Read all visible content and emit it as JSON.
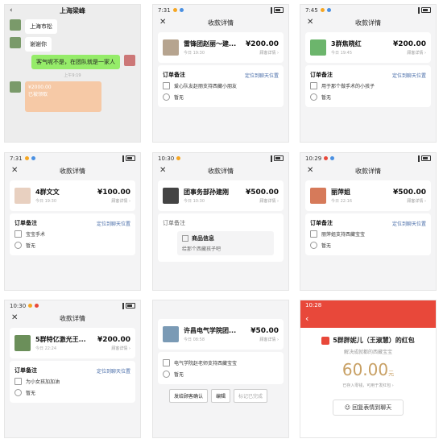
{
  "panels": {
    "p1": {
      "title": "上海梁峰",
      "msg_top": "上海市松",
      "msg_thanks": "谢谢你",
      "msg_reply": "客气呢不是，在团队就是一家人",
      "timestamp": "上午9:19",
      "rp_amount": "¥2000.00",
      "rp_label": "已被领取"
    },
    "p2": {
      "time": "7:31",
      "nav_title": "收款详情",
      "payer": "雷锋团赵丽～建...",
      "date": "今日 19:30",
      "amount": "¥200.00",
      "detail": "顾客详情 ›",
      "note_head": "订单备注",
      "locate": "定位到聊天位置",
      "note_text": "爱心队友赵丽支持西藏小朋友",
      "none_text": "暂无"
    },
    "p3": {
      "time": "7:45",
      "nav_title": "收款详情",
      "payer": "3群焦晓红",
      "date": "今日 19:45",
      "amount": "¥200.00",
      "detail": "顾客详情 ›",
      "note_head": "订单备注",
      "locate": "定位到聊天位置",
      "note_text": "用于那个做手术的小孩子",
      "none_text": "暂无"
    },
    "p4": {
      "time": "7:31",
      "nav_title": "收款详情",
      "payer": "4群文文",
      "date": "今日 19:30",
      "amount": "¥100.00",
      "detail": "顾客详情 ›",
      "note_head": "订单备注",
      "locate": "定位到聊天位置",
      "note_text": "宝宝手术",
      "none_text": "暂无"
    },
    "p5": {
      "time": "10:30",
      "nav_title": "收款详情",
      "payer": "团事务部孙建刚",
      "date": "今日 10:30",
      "amount": "¥500.00",
      "detail": "顾客详情 ›",
      "note_head": "订单备注",
      "prod_title": "商品信息",
      "prod_sub": "给那个西藏孩子吧"
    },
    "p6": {
      "time": "10:29",
      "nav_title": "收款详情",
      "payer": "丽萍姐",
      "date": "今日 22:16",
      "amount": "¥500.00",
      "detail": "顾客详情 ›",
      "note_head": "订单备注",
      "locate": "定位到聊天位置",
      "note_text": "丽萍姐支持西藏宝宝",
      "none_text": "暂无"
    },
    "p7": {
      "time": "10:30",
      "nav_title": "收款详情",
      "payer": "5群特亿激光王...",
      "date": "今日 22:24",
      "amount": "¥200.00",
      "detail": "顾客详情 ›",
      "note_head": "订单备注",
      "locate": "定位到聊天位置",
      "note_text": "为小女孩加加油",
      "none_text": "暂无"
    },
    "p8": {
      "payer": "许昌电气学院团...",
      "date": "今日 08:58",
      "amount": "¥50.00",
      "detail": "顾客详情 ›",
      "note_text": "电气学院赵老师支持西藏宝宝",
      "none_text": "暂无",
      "btn_send": "发给顾客确认",
      "btn_edit": "编辑",
      "btn_done": "标记已完成"
    },
    "p9": {
      "time": "10:28",
      "title": "5群胖妮儿（王淑慧）的红包",
      "sub": "解决成就都的西藏宝宝",
      "amount": "60.00",
      "unit": "元",
      "note": "已存入零钱，可用于发红包 ›",
      "reply_btn": "回复表情到聊天"
    }
  },
  "colors": {
    "link": "#4a6ea9",
    "red": "#e8483a",
    "green_bubble": "#95ec69",
    "gold": "#c8a064"
  }
}
